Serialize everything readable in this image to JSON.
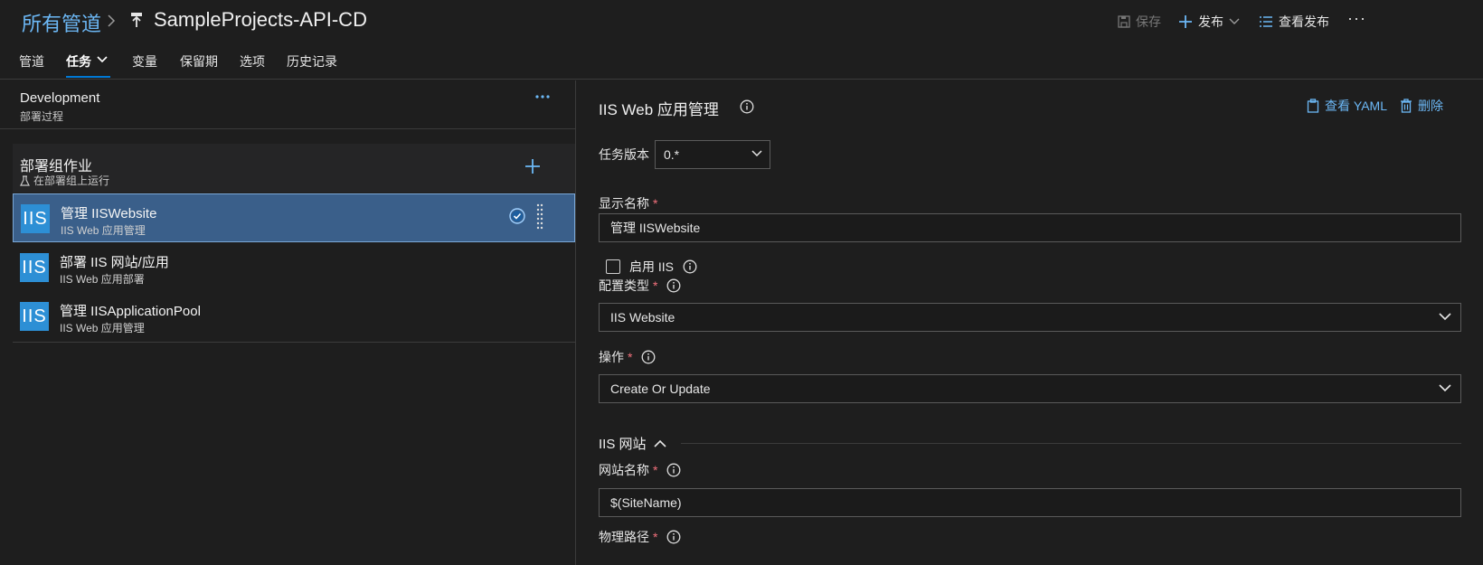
{
  "header": {
    "breadcrumb_root": "所有管道",
    "pipeline_title": "SampleProjects-API-CD",
    "save_label": "保存",
    "release_label": "发布",
    "view_releases_label": "查看发布",
    "more_label": "···"
  },
  "tabs": [
    {
      "label": "管道"
    },
    {
      "label": "任务"
    },
    {
      "label": "变量"
    },
    {
      "label": "保留期"
    },
    {
      "label": "选项"
    },
    {
      "label": "历史记录"
    }
  ],
  "stage": {
    "name": "Development",
    "subtitle": "部署过程",
    "more_label": "···"
  },
  "phase": {
    "name": "部署组作业",
    "subtitle": "在部署组上运行"
  },
  "tasks": [
    {
      "icon_text": "IIS",
      "name": "管理 IISWebsite",
      "subtitle": "IIS Web 应用管理",
      "selected": true
    },
    {
      "icon_text": "IIS",
      "name": "部署 IIS 网站/应用",
      "subtitle": "IIS Web 应用部署",
      "selected": false
    },
    {
      "icon_text": "IIS",
      "name": "管理 IISApplicationPool",
      "subtitle": "IIS Web 应用管理",
      "selected": false
    }
  ],
  "detail": {
    "title": "IIS Web 应用管理",
    "view_yaml_label": "查看 YAML",
    "delete_label": "删除",
    "task_version_label": "任务版本",
    "task_version_value": "0.*",
    "display_name_label": "显示名称",
    "display_name_value": "管理 IISWebsite",
    "enable_iis_label": "启用 IIS",
    "enable_iis_checked": false,
    "config_type_label": "配置类型",
    "config_type_value": "IIS Website",
    "action_label": "操作",
    "action_value": "Create Or Update",
    "section_label": "IIS 网站",
    "site_name_label": "网站名称",
    "site_name_value": "$(SiteName)",
    "physical_path_label": "物理路径",
    "required_mark": "*"
  },
  "colors": {
    "accent": "#0078d4",
    "link": "#6cb8f6",
    "selected_bg": "#3a5f8a",
    "required": "#f1707b"
  }
}
